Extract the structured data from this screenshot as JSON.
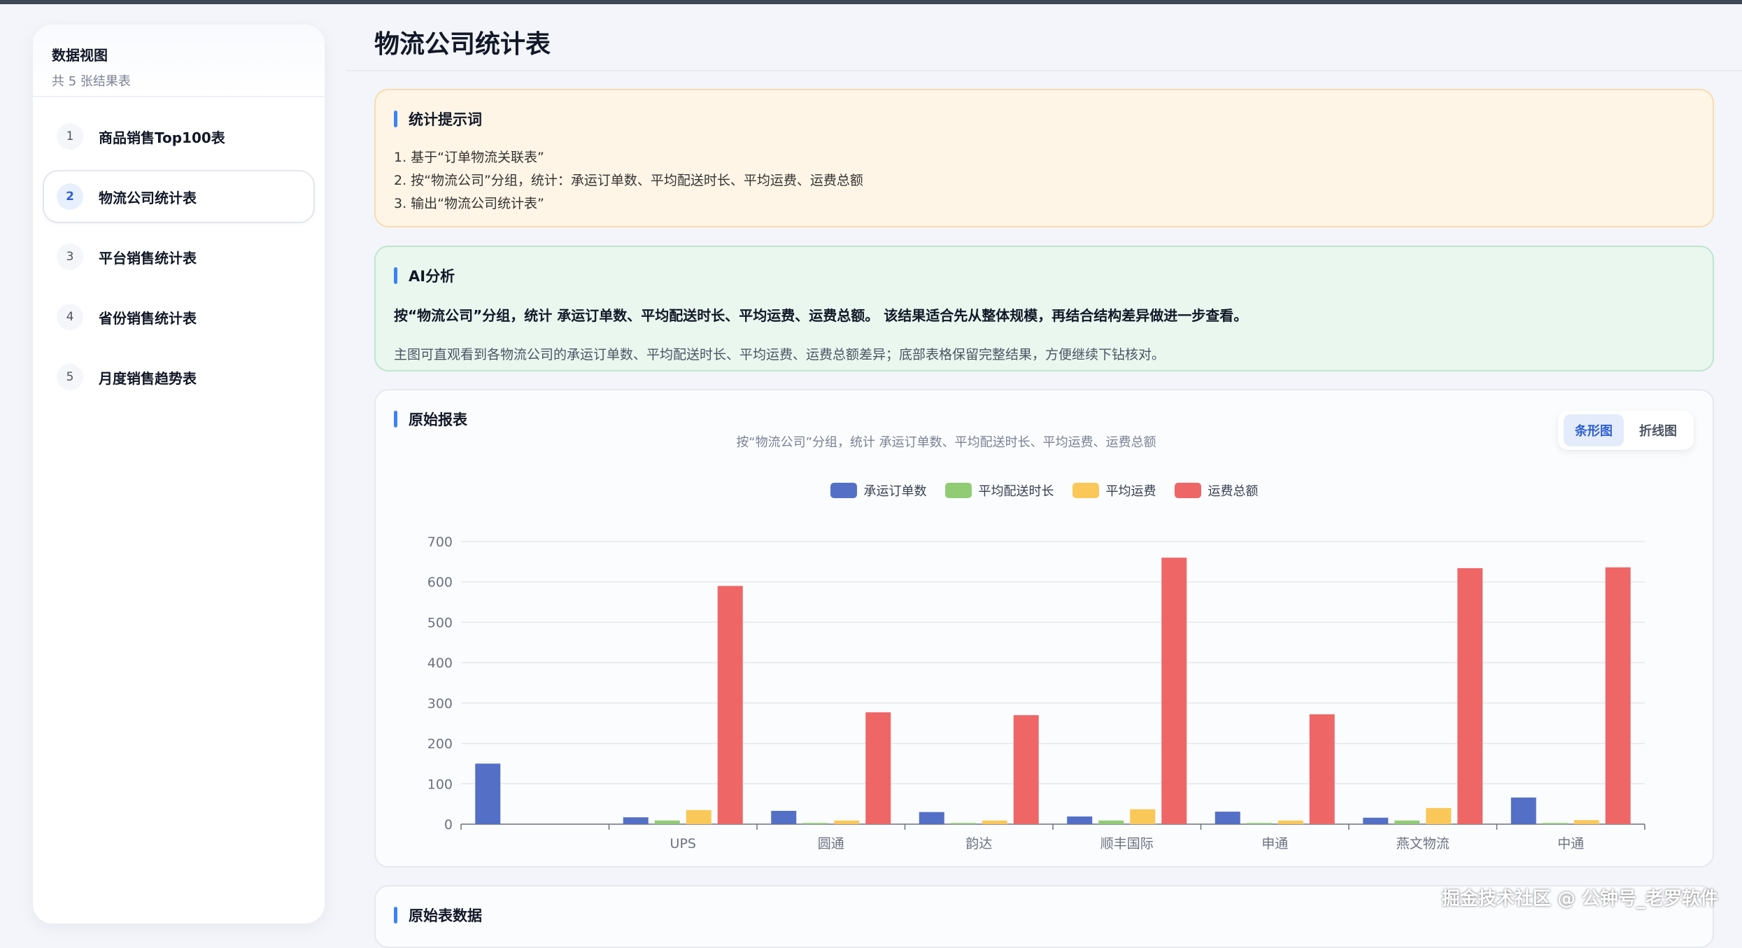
{
  "sidebar": {
    "title": "数据视图",
    "subtitle": "共 5 张结果表",
    "items": [
      {
        "num": "1",
        "label": "商品销售Top100表"
      },
      {
        "num": "2",
        "label": "物流公司统计表"
      },
      {
        "num": "3",
        "label": "平台销售统计表"
      },
      {
        "num": "4",
        "label": "省份销售统计表"
      },
      {
        "num": "5",
        "label": "月度销售趋势表"
      }
    ]
  },
  "page": {
    "title": "物流公司统计表"
  },
  "tips": {
    "title": "统计提示词",
    "lines": [
      "1. 基于“订单物流关联表”",
      "2. 按“物流公司”分组，统计：承运订单数、平均配送时长、平均运费、运费总额",
      "3. 输出“物流公司统计表”"
    ]
  },
  "ai": {
    "title": "AI分析",
    "summary": "按“物流公司”分组，统计 承运订单数、平均配送时长、平均运费、运费总额。 该结果适合先从整体规模，再结合结构差异做进一步查看。",
    "detail": "主图可直观看到各物流公司的承运订单数、平均配送时长、平均运费、运费总额差异；底部表格保留完整结果，方便继续下钻核对。"
  },
  "report": {
    "title": "原始报表",
    "subtitle": "按“物流公司”分组，统计 承运订单数、平均配送时长、平均运费、运费总额",
    "switch": {
      "bar": "条形图",
      "line": "折线图",
      "active": "bar"
    }
  },
  "rawdata": {
    "title": "原始表数据"
  },
  "watermark": "掘金技术社区 @ 公钟号_老罗软件",
  "chart_data": {
    "type": "bar",
    "categories": [
      "",
      "UPS",
      "圆通",
      "韵达",
      "顺丰国际",
      "申通",
      "燕文物流",
      "中通"
    ],
    "series": [
      {
        "name": "承运订单数",
        "color": "#5470c6",
        "values": [
          150,
          17,
          33,
          30,
          19,
          31,
          16,
          66
        ]
      },
      {
        "name": "平均配送时长",
        "color": "#91cc75",
        "values": [
          0,
          9,
          3,
          3,
          9,
          3,
          9,
          3
        ]
      },
      {
        "name": "平均运费",
        "color": "#fac858",
        "values": [
          0,
          35,
          9,
          9,
          37,
          9,
          40,
          10
        ]
      },
      {
        "name": "运费总额",
        "color": "#ee6666",
        "values": [
          0,
          590,
          277,
          270,
          660,
          272,
          634,
          636
        ]
      }
    ],
    "ylim": [
      0,
      700
    ],
    "yticks": [
      0,
      100,
      200,
      300,
      400,
      500,
      600,
      700
    ],
    "legend_position": "top-center",
    "grid": true
  }
}
